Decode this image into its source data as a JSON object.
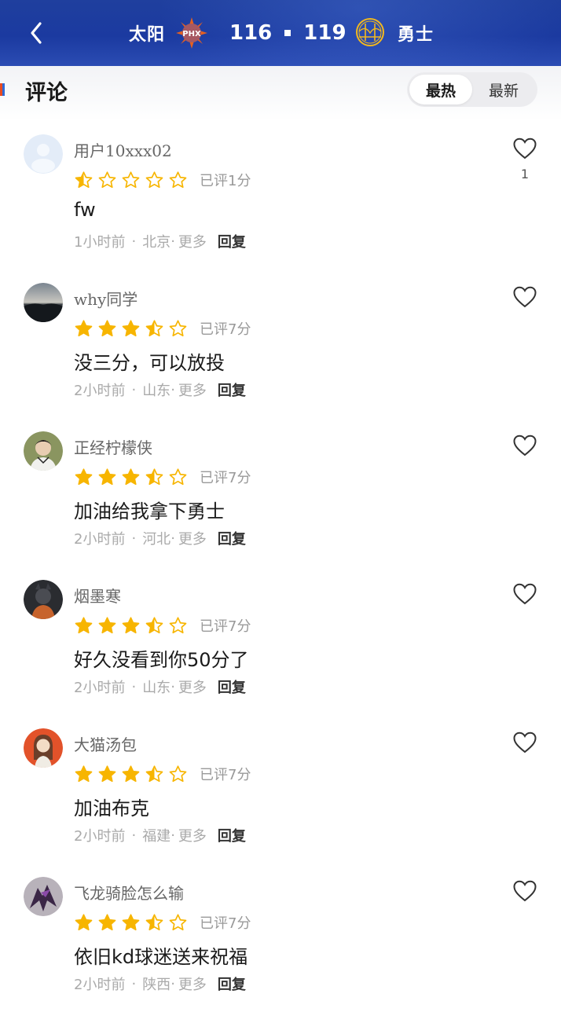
{
  "header": {
    "home_team": "太阳",
    "home_logo_text": "PHX",
    "home_score": "116",
    "away_score": "119",
    "away_team": "勇士",
    "colors": {
      "bg": "#1f3f9e",
      "home_logo": "#e56020",
      "away_logo": "#f2b81e"
    }
  },
  "section": {
    "title": "评论",
    "sort_options": [
      "最热",
      "最新"
    ],
    "sort_selected": "最热"
  },
  "comments": [
    {
      "username": "用户10xxx02",
      "stars": 1,
      "rating_text": "已评1分",
      "text": "fw",
      "time": "1小时前",
      "location": "北京",
      "more": "更多",
      "reply": "回复",
      "likes": "1",
      "avatar": "default"
    },
    {
      "username": "why同学",
      "stars": 7,
      "rating_text": "已评7分",
      "text": "没三分，可以放投",
      "time": "2小时前",
      "location": "山东",
      "more": "更多",
      "reply": "回复",
      "likes": "",
      "avatar": "landscape"
    },
    {
      "username": "正经柠檬侠",
      "stars": 7,
      "rating_text": "已评7分",
      "text": "加油给我拿下勇士",
      "time": "2小时前",
      "location": "河北",
      "more": "更多",
      "reply": "回复",
      "likes": "",
      "avatar": "person"
    },
    {
      "username": "烟墨寒",
      "stars": 7,
      "rating_text": "已评7分",
      "text": "好久没看到你50分了",
      "time": "2小时前",
      "location": "山东",
      "more": "更多",
      "reply": "回复",
      "likes": "",
      "avatar": "dark-figure"
    },
    {
      "username": "大猫汤包",
      "stars": 7,
      "rating_text": "已评7分",
      "text": "加油布克",
      "time": "2小时前",
      "location": "福建",
      "more": "更多",
      "reply": "回复",
      "likes": "",
      "avatar": "anime"
    },
    {
      "username": "飞龙骑脸怎么输",
      "stars": 7,
      "rating_text": "已评7分",
      "text": "依旧kd球迷送来祝福",
      "time": "2小时前",
      "location": "陕西",
      "more": "更多",
      "reply": "回复",
      "likes": "",
      "avatar": "dragon"
    }
  ],
  "icons": {
    "back": "chevron-left-icon",
    "like": "heart-outline-icon",
    "star_full": "star-filled-icon",
    "star_half": "star-half-icon",
    "star_empty": "star-outline-icon",
    "star_color": "#f7b500"
  }
}
